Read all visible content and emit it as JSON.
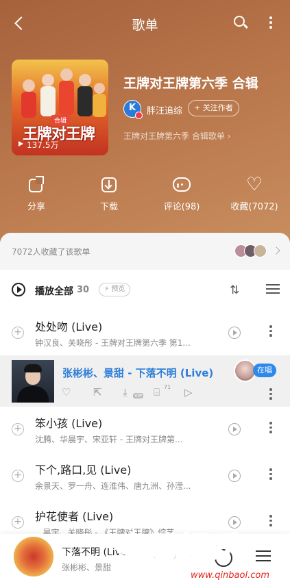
{
  "header": {
    "title": "歌单"
  },
  "playlist": {
    "cover_badge": "合辑",
    "cover_logo": "王牌对王牌",
    "play_count": "137.5万",
    "title": "王牌对王牌第六季 合辑",
    "creator": "胖汪追综",
    "follow_label": "+ 关注作者",
    "description": "王牌对王牌第六季 合辑歌单"
  },
  "actions": [
    {
      "label": "分享"
    },
    {
      "label": "下载"
    },
    {
      "label": "评论(98)"
    },
    {
      "label": "收藏(7072)"
    }
  ],
  "collected": {
    "text": "7072人收藏了该歌单"
  },
  "play_all": {
    "label": "播放全部",
    "count": "30",
    "preview": "预览"
  },
  "songs": [
    {
      "title": "处处吻 (Live)",
      "subtitle": "钟汉良、关晓彤 - 王牌对王牌第六季 第1..."
    },
    {
      "title": "笨小孩 (Live)",
      "subtitle": "沈腾、华晨宇、宋亚轩 - 王牌对王牌第..."
    },
    {
      "title": "下个,路口,见 (Live)",
      "subtitle": "余景天、罗一舟、连淮伟、唐九洲、孙滢..."
    },
    {
      "title": "护花使者 (Live)",
      "subtitle": "...昊宇、关晓彤 - 《王牌对王牌》综艺..."
    }
  ],
  "now_playing_row": {
    "title": "张彬彬、景甜 - 下落不明 (Live)",
    "comment_count": "71",
    "vip": "VIP",
    "singing_badge": "在唱"
  },
  "mini_player": {
    "title": "下落不明 (Live)",
    "artist": "张彬彬、景甜"
  },
  "watermark": {
    "text": "秦巴娱乐",
    "url": "www.qinbaol.com"
  },
  "colors": {
    "hero": "#b8754a",
    "accent": "#2f7fd8",
    "badge": "#2f89ea"
  }
}
